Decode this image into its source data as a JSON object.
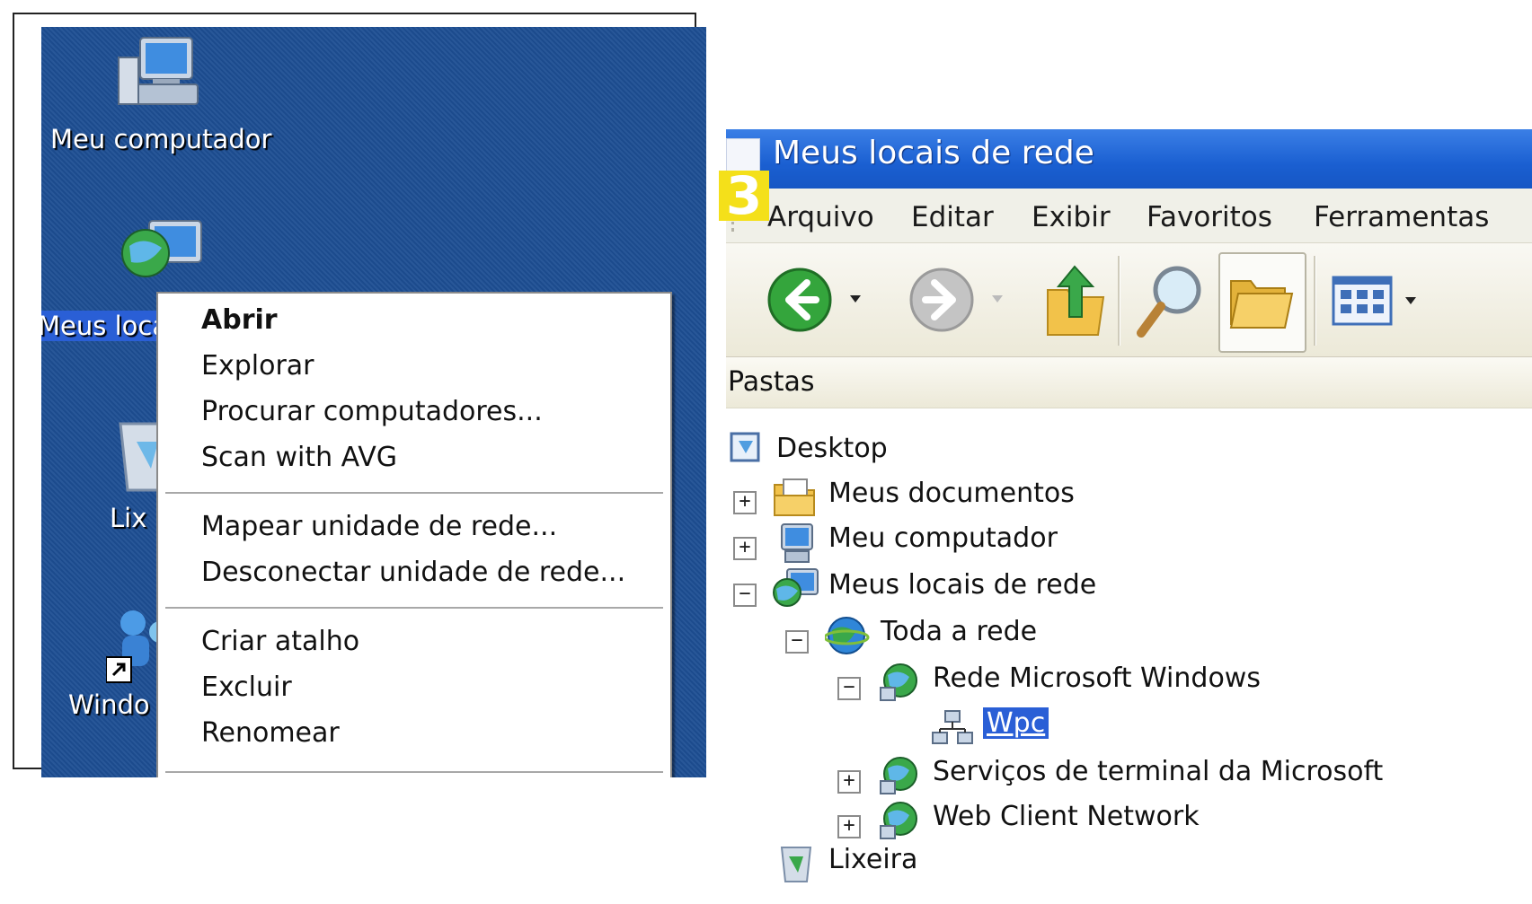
{
  "desktop": {
    "icons": [
      {
        "label": "Meu computador"
      },
      {
        "label": "Meus loca"
      },
      {
        "label": "Lix"
      },
      {
        "label": "Windo"
      }
    ]
  },
  "context_menu": {
    "items": [
      {
        "label": "Abrir",
        "bold": true
      },
      {
        "label": "Explorar"
      },
      {
        "label": "Procurar computadores..."
      },
      {
        "label": "Scan with AVG"
      },
      {
        "label": "Mapear unidade de rede..."
      },
      {
        "label": "Desconectar unidade de rede..."
      },
      {
        "label": "Criar atalho"
      },
      {
        "label": "Excluir"
      },
      {
        "label": "Renomear"
      }
    ]
  },
  "explorer": {
    "title": "Meus locais de rede",
    "menu": [
      "Arquivo",
      "Editar",
      "Exibir",
      "Favoritos",
      "Ferramentas"
    ],
    "badge": "3",
    "toolbar_icons": [
      "back-icon",
      "forward-icon",
      "up-folder-icon",
      "search-icon",
      "folders-icon",
      "views-icon"
    ],
    "folders_pane_label": "Pastas",
    "tree": [
      {
        "label": "Desktop",
        "expander": ""
      },
      {
        "label": "Meus documentos",
        "expander": "+"
      },
      {
        "label": "Meu computador",
        "expander": "+"
      },
      {
        "label": "Meus locais de rede",
        "expander": "−"
      },
      {
        "label": "Toda a rede",
        "expander": "−"
      },
      {
        "label": "Rede Microsoft Windows",
        "expander": "−"
      },
      {
        "label": "Wpc",
        "expander": "",
        "selected": true
      },
      {
        "label": "Serviços de terminal da Microsoft",
        "expander": "+"
      },
      {
        "label": "Web Client Network",
        "expander": "+"
      },
      {
        "label": "Lixeira",
        "expander": ""
      }
    ]
  },
  "colors": {
    "desktop_blue": "#1d4e93",
    "titlebar_blue": "#1a5fd1",
    "badge_yellow": "#f4e01a",
    "selection_blue": "#2a5fd6"
  }
}
